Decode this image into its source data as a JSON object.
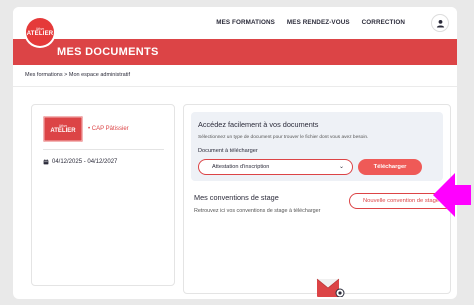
{
  "logo": {
    "line1": "Mon",
    "line2": "ATELIER"
  },
  "nav": {
    "items": [
      "MES FORMATIONS",
      "MES RENDEZ-VOUS",
      "CORRECTION"
    ]
  },
  "banner": {
    "title": "MES DOCUMENTS"
  },
  "breadcrumb": "Mes formations > Mon espace administratif",
  "formation": {
    "logo_line1": "Mon",
    "logo_line2": "ATELIER",
    "course": "• CAP Pâtissier",
    "dates": "04/12/2025 - 04/12/2027"
  },
  "documents": {
    "title": "Accédez facilement à vos documents",
    "hint": "Sélectionnez un type de document pour trouver le fichier dont vous avez besoin.",
    "label": "Document à télécharger",
    "selected": "Attestation d'inscription",
    "download_label": "Télécharger"
  },
  "conventions": {
    "title": "Mes conventions de stage",
    "hint": "Retrouvez ici vos conventions de stage à télécharger",
    "new_label": "Nouvelle convention de stage"
  },
  "colors": {
    "brand": "#dc4446",
    "button": "#ef5a57",
    "annotation": "#ff00ff"
  },
  "icons": [
    "user-icon",
    "calendar-icon",
    "chevron-down-icon",
    "document-illustration-icon",
    "annotation-arrow-icon"
  ]
}
